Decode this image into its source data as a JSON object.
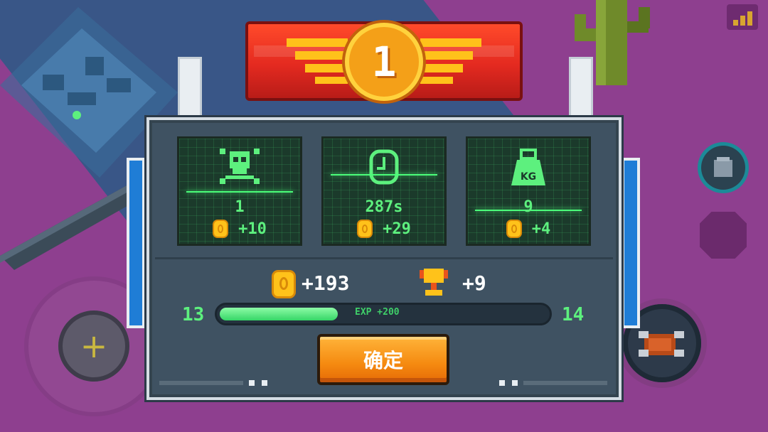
{
  "result": {
    "rank": "1",
    "stats": [
      {
        "id": "kills",
        "icon": "skull-icon",
        "value": "1",
        "reward": "+10"
      },
      {
        "id": "time",
        "icon": "clock-icon",
        "value": "287s",
        "reward": "+29"
      },
      {
        "id": "weight",
        "icon": "weight-icon",
        "icon_text": "KG",
        "value": "9",
        "reward": "+4"
      }
    ],
    "total_coins": "+193",
    "total_trophies": "+9"
  },
  "experience": {
    "current_level": "13",
    "next_level": "14",
    "label": "EXP +200",
    "progress": 0.36
  },
  "confirm_label": "确定",
  "colors": {
    "accent_green": "#5df07e",
    "coin_gold": "#ffc21a",
    "banner_red": "#e42a20",
    "button_orange": "#f58a10"
  }
}
